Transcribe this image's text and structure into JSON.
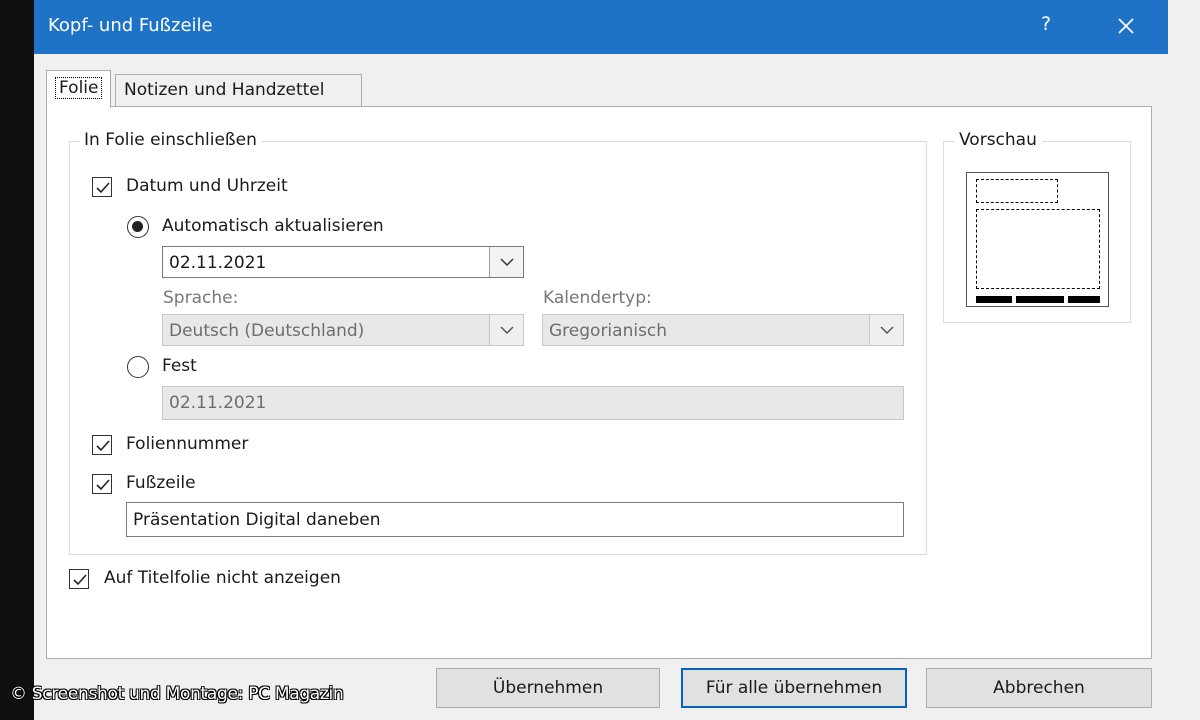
{
  "window": {
    "title": "Kopf- und Fußzeile",
    "help_label": "?"
  },
  "tabs": [
    {
      "label": "Folie",
      "active": true
    },
    {
      "label": "Notizen und Handzettel",
      "active": false
    }
  ],
  "include_group": {
    "legend": "In Folie einschließen",
    "date_time": {
      "label": "Datum und Uhrzeit",
      "checked": true
    },
    "auto_update": {
      "label": "Automatisch aktualisieren",
      "selected": true,
      "value": "02.11.2021"
    },
    "language": {
      "label": "Sprache:",
      "value": "Deutsch (Deutschland)"
    },
    "calendar_type": {
      "label": "Kalendertyp:",
      "value": "Gregorianisch"
    },
    "fixed": {
      "label": "Fest",
      "selected": false,
      "value": "02.11.2021"
    },
    "slide_number": {
      "label": "Foliennummer",
      "checked": true
    },
    "footer": {
      "label": "Fußzeile",
      "checked": true,
      "value": "Präsentation Digital daneben"
    }
  },
  "hide_on_title": {
    "label": "Auf Titelfolie nicht anzeigen",
    "checked": true
  },
  "preview": {
    "legend": "Vorschau"
  },
  "buttons": {
    "apply": "Übernehmen",
    "apply_all": "Für alle übernehmen",
    "cancel": "Abbrechen"
  },
  "watermark": "© Screenshot und Montage: PC Magazin",
  "colors": {
    "titlebar": "#1f73c6",
    "default_button_border": "#0a5fbd"
  }
}
